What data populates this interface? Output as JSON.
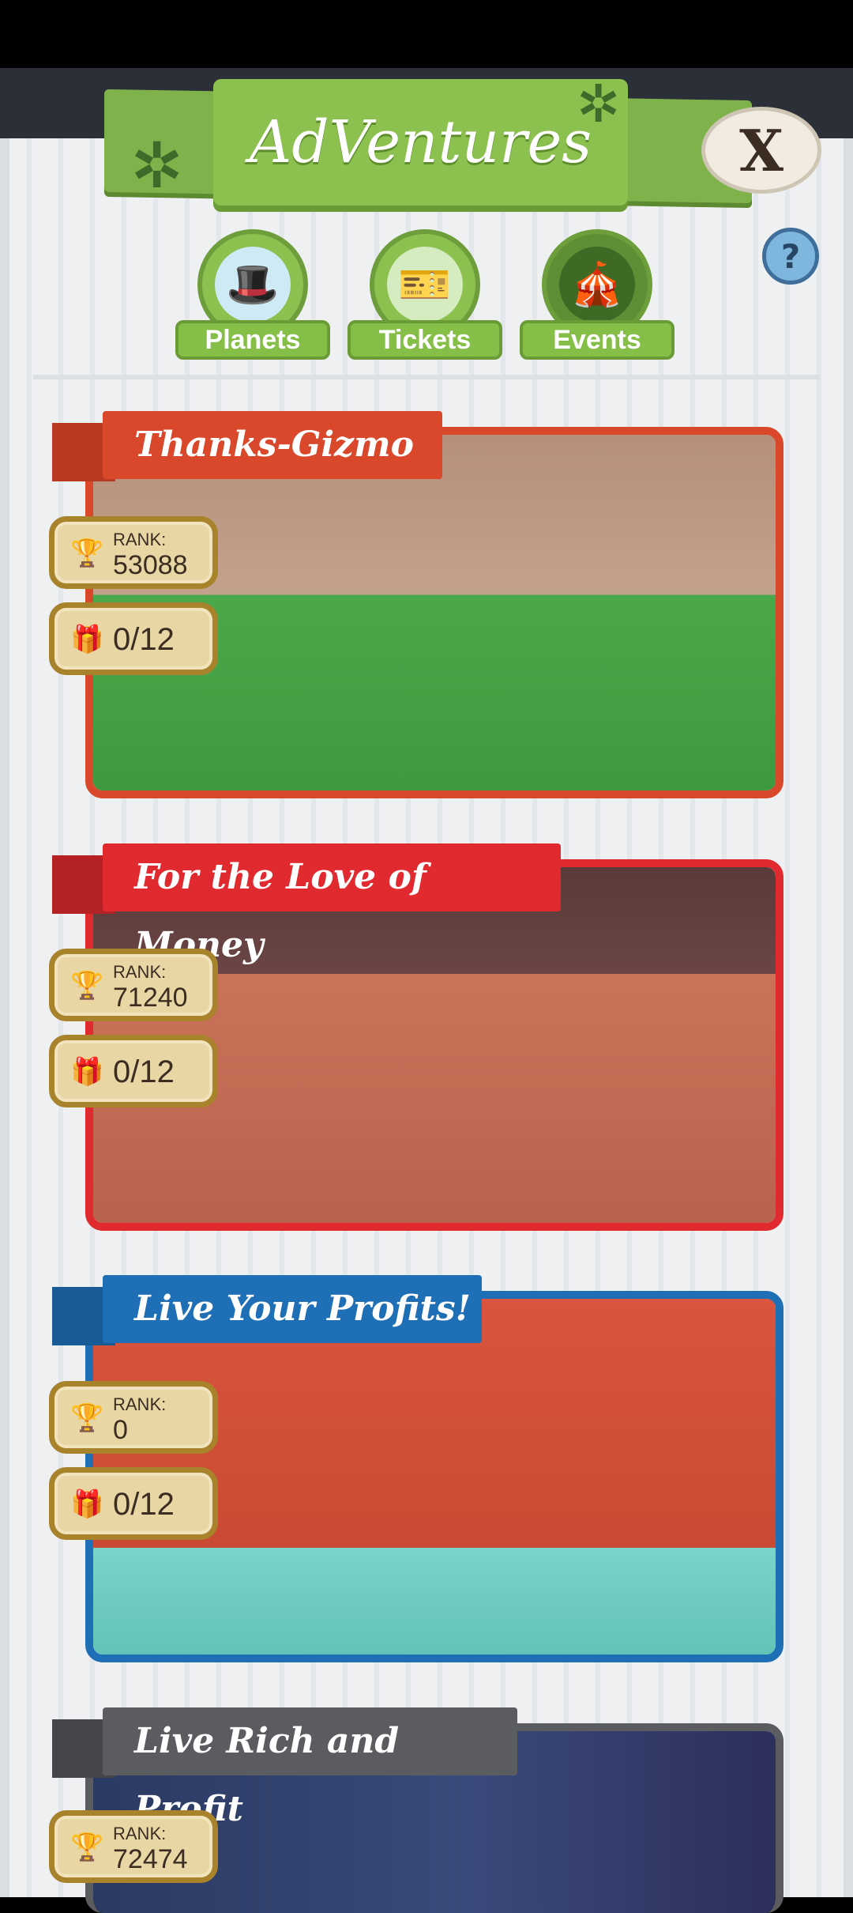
{
  "header": {
    "title": "AdVentures",
    "close_label": "X",
    "help_label": "?"
  },
  "tabs": [
    {
      "label": "Planets",
      "icon": "top-hat-icon"
    },
    {
      "label": "Tickets",
      "icon": "ticket-icon"
    },
    {
      "label": "Events",
      "icon": "event-hat-icon"
    }
  ],
  "events": [
    {
      "title": "Thanks-Gizmo",
      "rank_label": "RANK:",
      "rank": "53088",
      "rewards": "0/12",
      "color": "#d9482a"
    },
    {
      "title": "For the Love of Money",
      "rank_label": "RANK:",
      "rank": "71240",
      "rewards": "0/12",
      "color": "#e02a2f"
    },
    {
      "title": "Live Your Profits!",
      "rank_label": "RANK:",
      "rank": "0",
      "rewards": "0/12",
      "color": "#1f6fb7"
    },
    {
      "title": "Live Rich and Profit",
      "rank_label": "RANK:",
      "rank": "72474",
      "rewards": "",
      "color": "#5a5c60"
    }
  ]
}
